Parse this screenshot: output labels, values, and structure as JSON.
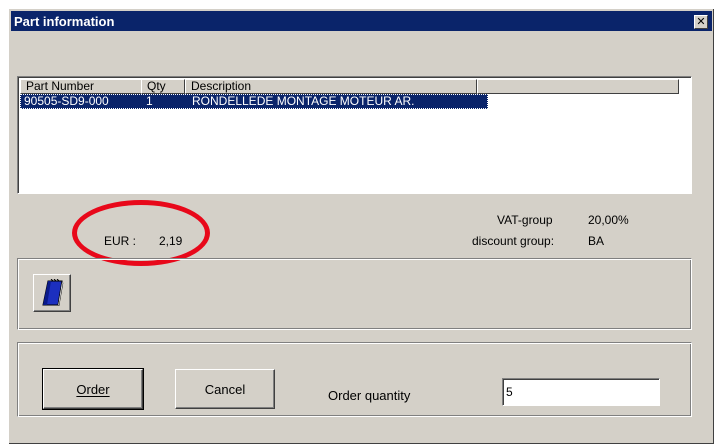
{
  "window": {
    "title": "Part information",
    "close_glyph": "✕"
  },
  "list": {
    "columns": [
      "Part Number",
      "Qty",
      "Description"
    ],
    "rows": [
      {
        "part_number": "90505-SD9-000",
        "qty": "1",
        "description": "RONDELLEDE MONTAGE MOTEUR AR."
      }
    ]
  },
  "price": {
    "currency_label": "EUR :",
    "value": "2,19"
  },
  "vat": {
    "vat_group_label": "VAT-group",
    "vat_group_value": "20,00%",
    "discount_group_label": "discount group:",
    "discount_group_value": "BA"
  },
  "buttons": {
    "order": "Order",
    "cancel": "Cancel"
  },
  "order_quantity": {
    "label": "Order quantity",
    "value": "5"
  },
  "colors": {
    "title_bar": "#0a246a",
    "annotation_circle": "#e8081a",
    "dialog_face": "#d4d0c8"
  }
}
